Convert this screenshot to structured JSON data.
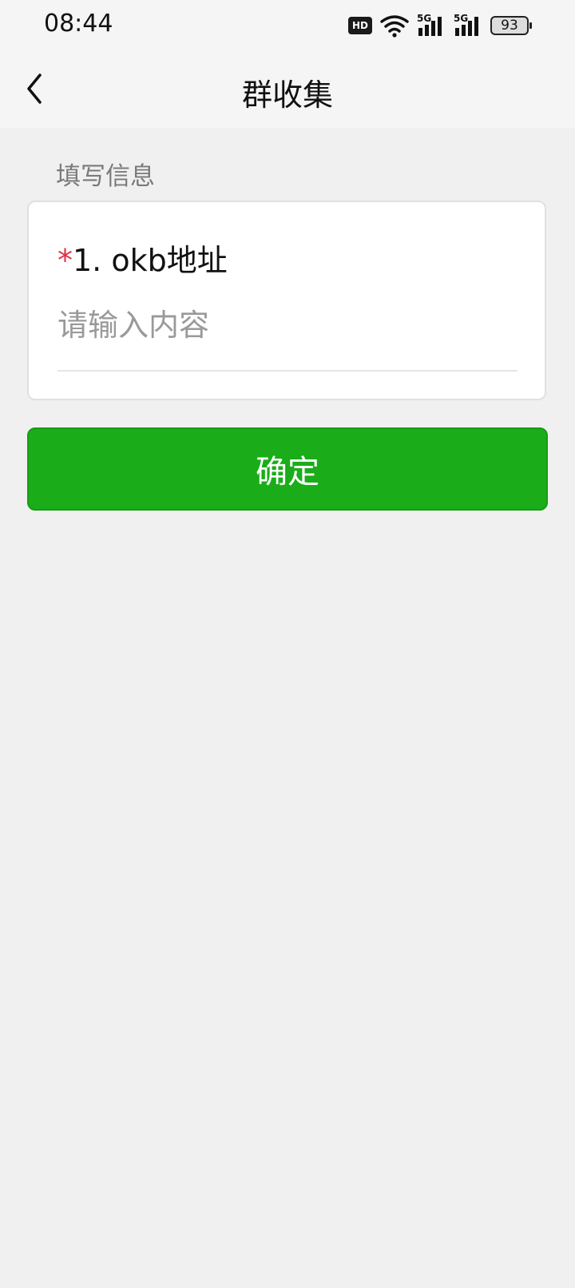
{
  "status_bar": {
    "time": "08:44",
    "hd_badge": "HD",
    "signal_1_label": "5G",
    "signal_2_label": "5G",
    "battery_level": "93",
    "icons": [
      "hd-icon",
      "wifi-icon",
      "signal-5g-icon",
      "signal-5g-icon",
      "battery-icon"
    ]
  },
  "nav": {
    "title": "群收集",
    "back_icon": "chevron-left-icon"
  },
  "form": {
    "section_label": "填写信息",
    "fields": [
      {
        "required_mark": "*",
        "label": "1. okb地址",
        "value": "",
        "placeholder": "请输入内容"
      }
    ]
  },
  "actions": {
    "confirm_label": "确定"
  },
  "colors": {
    "accent": "#1aad19",
    "required": "#e0314b",
    "background": "#f0f0f0"
  }
}
